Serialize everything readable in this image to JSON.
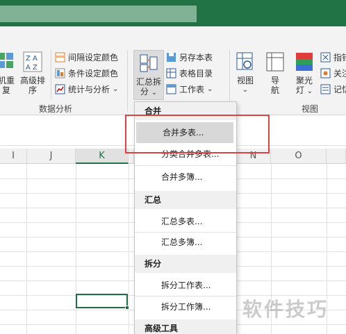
{
  "ribbon": {
    "left_buttons": [
      {
        "label1": "机重",
        "label2": "复"
      },
      {
        "label1": "高级排",
        "label2": "序"
      }
    ],
    "mid_small": [
      {
        "label": "间隔设定颜色"
      },
      {
        "label": "条件设定颜色"
      },
      {
        "label": "统计与分析"
      }
    ],
    "group_data_analysis": "数据分析",
    "split_button": {
      "label1": "汇总拆",
      "label2": "分"
    },
    "right_small": [
      {
        "label": "另存本表"
      },
      {
        "label": "表格目录"
      },
      {
        "label": "工作表"
      }
    ],
    "view_buttons": [
      {
        "label1": "视图",
        "label2": "",
        "chev": "⌄"
      },
      {
        "label1": "导",
        "label2": "航"
      },
      {
        "label1": "聚光",
        "label2": "灯"
      }
    ],
    "far_right": [
      {
        "label": "指针"
      },
      {
        "label": "关注"
      },
      {
        "label": "记忆"
      }
    ],
    "group_view": "视图"
  },
  "columns": [
    {
      "name": "I"
    },
    {
      "name": "J"
    },
    {
      "name": "K"
    },
    {
      "name": "N"
    },
    {
      "name": "O"
    }
  ],
  "menu": {
    "sections": [
      {
        "header": "合并",
        "items": [
          "合并多表...",
          "分类合并多表...",
          "合并多簿..."
        ]
      },
      {
        "header": "汇总",
        "items": [
          "汇总多表...",
          "汇总多簿..."
        ]
      },
      {
        "header": "拆分",
        "items": [
          "拆分工作表...",
          "拆分工作簿..."
        ]
      },
      {
        "header": "高级工具",
        "items": []
      }
    ]
  },
  "watermark": "软件技巧",
  "colors": {
    "accent": "#217346",
    "highlight_box": "#e0403e"
  }
}
